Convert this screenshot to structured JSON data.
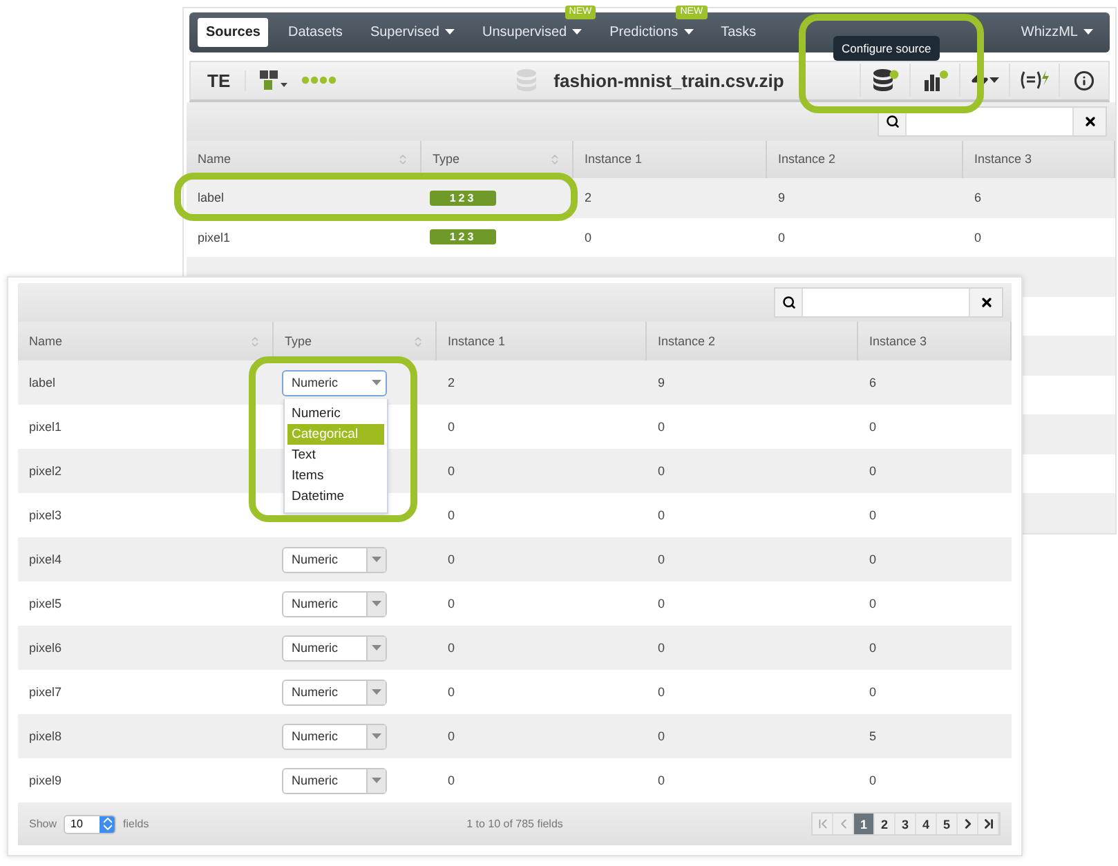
{
  "back": {
    "nav": [
      {
        "label": "Sources",
        "selected": true
      },
      {
        "label": "Datasets",
        "selected": false
      },
      {
        "label": "Supervised",
        "selected": false,
        "caret": true
      },
      {
        "label": "Unsupervised",
        "selected": false,
        "caret": true,
        "badge": "NEW"
      },
      {
        "label": "Predictions",
        "selected": false,
        "caret": true,
        "badge": "NEW"
      },
      {
        "label": "Tasks",
        "selected": false
      }
    ],
    "nav_right": {
      "label": "WhizzML",
      "caret": true
    },
    "toolbar": {
      "abbrev": "TE",
      "filename": "fashion-mnist_train.csv.zip"
    },
    "tooltip": "Configure source",
    "table": {
      "columns": [
        {
          "label": "Name",
          "sortable": true
        },
        {
          "label": "Type",
          "sortable": true
        },
        {
          "label": "Instance 1",
          "sortable": false
        },
        {
          "label": "Instance 2",
          "sortable": false
        },
        {
          "label": "Instance 3",
          "sortable": false
        }
      ],
      "rows": [
        {
          "name": "label",
          "type": "123",
          "values": [
            "2",
            "9",
            "6"
          ]
        },
        {
          "name": "pixel1",
          "type": "123",
          "values": [
            "0",
            "0",
            "0"
          ]
        }
      ]
    }
  },
  "front": {
    "table": {
      "columns": [
        {
          "label": "Name",
          "sortable": true
        },
        {
          "label": "Type",
          "sortable": true
        },
        {
          "label": "Instance 1",
          "sortable": false
        },
        {
          "label": "Instance 2",
          "sortable": false
        },
        {
          "label": "Instance 3",
          "sortable": false
        }
      ],
      "rows": [
        {
          "name": "label",
          "type": "Numeric",
          "focused": true,
          "values": [
            "2",
            "9",
            "6"
          ]
        },
        {
          "name": "pixel1",
          "values": [
            "0",
            "0",
            "0"
          ]
        },
        {
          "name": "pixel2",
          "values": [
            "0",
            "0",
            "0"
          ]
        },
        {
          "name": "pixel3",
          "values": [
            "0",
            "0",
            "0"
          ]
        },
        {
          "name": "pixel4",
          "type": "Numeric",
          "focused": false,
          "values": [
            "0",
            "0",
            "0"
          ]
        },
        {
          "name": "pixel5",
          "type": "Numeric",
          "focused": false,
          "values": [
            "0",
            "0",
            "0"
          ]
        },
        {
          "name": "pixel6",
          "type": "Numeric",
          "focused": false,
          "values": [
            "0",
            "0",
            "0"
          ]
        },
        {
          "name": "pixel7",
          "type": "Numeric",
          "focused": false,
          "values": [
            "0",
            "0",
            "0"
          ]
        },
        {
          "name": "pixel8",
          "type": "Numeric",
          "focused": false,
          "values": [
            "0",
            "0",
            "5"
          ]
        },
        {
          "name": "pixel9",
          "type": "Numeric",
          "focused": false,
          "values": [
            "0",
            "0",
            "0"
          ]
        }
      ]
    },
    "dropdown": [
      {
        "label": "Numeric",
        "selected": false
      },
      {
        "label": "Categorical",
        "selected": true
      },
      {
        "label": "Text",
        "selected": false
      },
      {
        "label": "Items",
        "selected": false
      },
      {
        "label": "Datetime",
        "selected": false
      }
    ],
    "footer": {
      "show_label": "Show",
      "page_size": "10",
      "fields_label": "fields",
      "range": "1 to 10 of 785 fields",
      "pages": [
        {
          "label": "1",
          "selected": true
        },
        {
          "label": "2",
          "selected": false
        },
        {
          "label": "3",
          "selected": false
        },
        {
          "label": "4",
          "selected": false
        },
        {
          "label": "5",
          "selected": false
        }
      ]
    }
  }
}
